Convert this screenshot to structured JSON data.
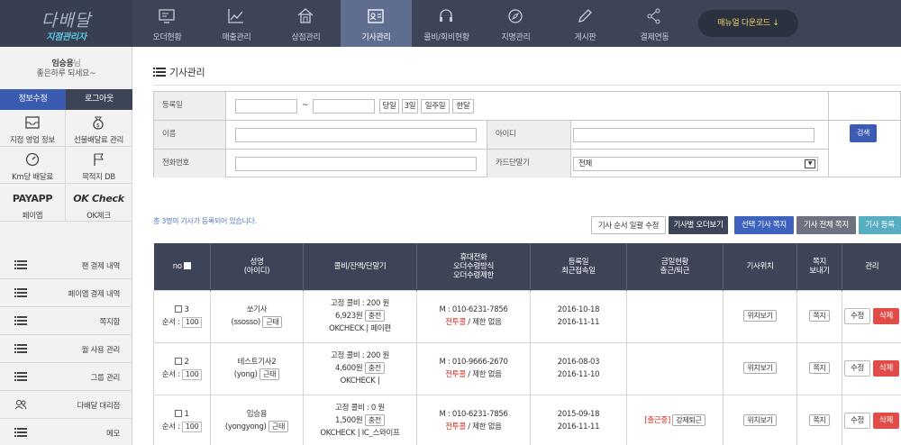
{
  "logo": {
    "line1": "다배달",
    "line2": "지점관리자"
  },
  "nav": {
    "items": [
      {
        "label": "오더현황",
        "icon": "monitor-icon"
      },
      {
        "label": "매출관리",
        "icon": "chart-icon"
      },
      {
        "label": "상점관리",
        "icon": "house-icon"
      },
      {
        "label": "기사관리",
        "icon": "id-card-icon"
      },
      {
        "label": "콜비/회비현황",
        "icon": "headset-icon"
      },
      {
        "label": "지명관리",
        "icon": "compass-icon"
      },
      {
        "label": "게시판",
        "icon": "pencil-icon"
      },
      {
        "label": "결제연동",
        "icon": "share-icon"
      }
    ],
    "download": "매뉴얼 다운로드 ↓"
  },
  "user": {
    "name": "임승용",
    "suffix": "님",
    "greeting": "좋은하루 되세요~",
    "edit_btn": "정보수정",
    "logout_btn": "로그아웃"
  },
  "sidebar": {
    "grid": [
      {
        "label": "지점 영업 정보"
      },
      {
        "label": "선불배달료 관리"
      },
      {
        "label": "Km당 배달료"
      },
      {
        "label": "목적지 DB"
      },
      {
        "label": "페이앱",
        "title": "PAYAPP"
      },
      {
        "label": "OK체크",
        "title": "OK Check"
      }
    ],
    "menu": [
      "팬 결제 내역",
      "페이앱 결제 내역",
      "쪽지함",
      "월 사용 관리",
      "그룹 관리",
      "다배달 대리점",
      "메모"
    ]
  },
  "page": {
    "title": "기사관리"
  },
  "search": {
    "reg_date_label": "등록일",
    "tilde": "~",
    "quick": [
      "당일",
      "3일",
      "일주일",
      "한달"
    ],
    "name_label": "이름",
    "id_label": "아이디",
    "phone_label": "전화번호",
    "card_label": "카드단말기",
    "card_value": "전체",
    "search_btn": "검색"
  },
  "list": {
    "count_text": "총 3명의 기사가 등록되어 있습니다.",
    "actions": [
      "기사 순서 일괄 수정",
      "기사별 오더보기",
      "선택 기사 쪽지",
      "기사 전체 쪽지",
      "기사 등록"
    ]
  },
  "table": {
    "headers": {
      "no": "no",
      "name": [
        "성명",
        "(아이디)"
      ],
      "fee": "콜비/잔액/단말기",
      "phone": [
        "휴대전화",
        "오더수령방식",
        "오더수령제한"
      ],
      "reg": [
        "등록일",
        "최근접속일"
      ],
      "today": [
        "금일현황",
        "출근/퇴근"
      ],
      "loc": "기사위치",
      "msg": [
        "쪽지",
        "보내기"
      ],
      "manage": "관리"
    },
    "order_label": "순서 :",
    "status_tag": "근태",
    "charge_btn": "충전",
    "loc_btn": "위치보기",
    "msg_btn": "쪽지",
    "edit_btn": "수정",
    "del_btn": "삭제",
    "rows": [
      {
        "no": "3",
        "order": "100",
        "name": "쏘기사",
        "id": "(ssosso)",
        "fee": "고정 콜비 : 200 원",
        "balance": "6,923원",
        "terminal": "OKCHECK | 페이편",
        "phone": "M : 010-6231-7856",
        "method": "전투콜",
        "limit": " / 제한 없음",
        "reg": "2016-10-18",
        "last": "2016-11-11",
        "today": "",
        "leave": ""
      },
      {
        "no": "2",
        "order": "100",
        "name": "테스트기사2",
        "id": "(yong)",
        "fee": "고정 콜비 : 200 원",
        "balance": "4,600원",
        "terminal": "OKCHECK |",
        "phone": "M : 010-9666-2670",
        "method": "전투콜",
        "limit": " / 제한 없음",
        "reg": "2016-08-03",
        "last": "2016-11-10",
        "today": "",
        "leave": ""
      },
      {
        "no": "1",
        "order": "100",
        "name": "임승용",
        "id": "(yongyong)",
        "fee": "고정 콜비 : 0 원",
        "balance": "1,500원",
        "terminal": "OKCHECK | IC_스와이프",
        "phone": "M : 010-6231-7856",
        "method": "전투콜",
        "limit": " / 제한 없음",
        "reg": "2015-09-18",
        "last": "2016-11-11",
        "today": "[출근중]",
        "leave": "강제퇴근"
      }
    ]
  }
}
